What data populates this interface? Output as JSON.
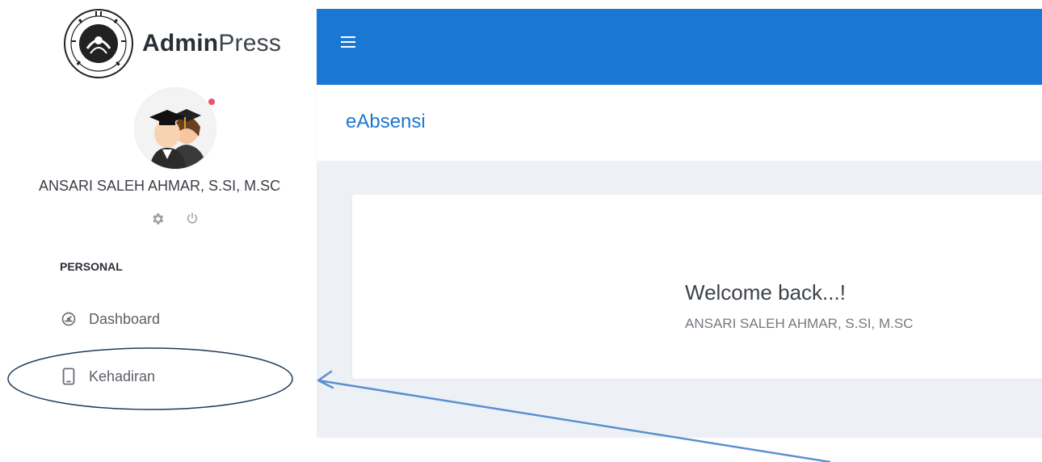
{
  "brand": {
    "logo_icon": "university-seal-icon",
    "bold_text": "Admin",
    "light_text": "Press"
  },
  "user": {
    "name": "ANSARI SALEH AHMAR, S.SI, M.SC",
    "avatar_icon": "graduates-avatar-icon",
    "status_color": "#f0506e",
    "settings_icon": "gear-icon",
    "logout_icon": "power-icon"
  },
  "sidebar": {
    "section_title": "PERSONAL",
    "items": [
      {
        "label": "Dashboard",
        "icon": "gauge-icon"
      },
      {
        "label": "Kehadiran",
        "icon": "mobile-phone-icon"
      }
    ]
  },
  "topbar": {
    "menu_icon": "hamburger-icon",
    "color": "#1b77d4"
  },
  "header": {
    "title": "eAbsensi"
  },
  "card": {
    "welcome_title": "Welcome back...!",
    "welcome_name": "ANSARI SALEH AHMAR, S.SI, M.SC"
  },
  "annotation": {
    "shape": "ellipse-with-arrow",
    "color": "#5b8fd0",
    "target": "Kehadiran"
  }
}
